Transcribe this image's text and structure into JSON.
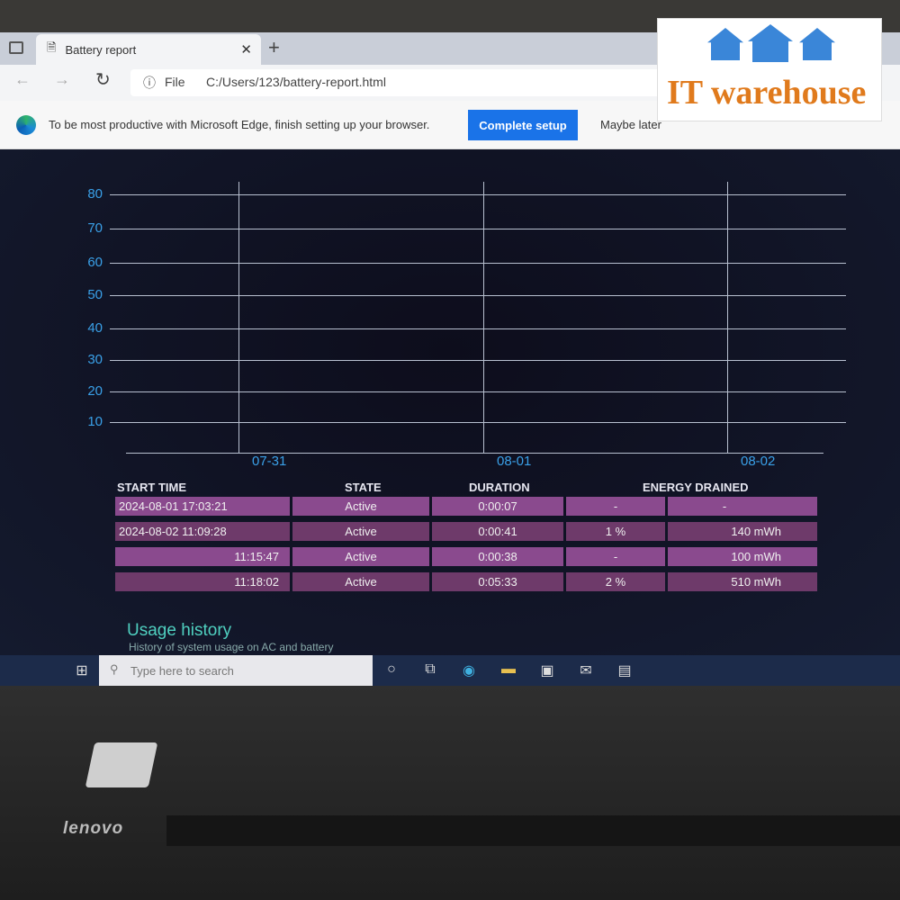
{
  "browser": {
    "tab_title": "Battery report",
    "address_prefix": "File",
    "url": "C:/Users/123/battery-report.html"
  },
  "infobar": {
    "message": "To be most productive with Microsoft Edge, finish setting up your browser.",
    "primary": "Complete setup",
    "secondary": "Maybe later"
  },
  "chart": {
    "y_ticks": [
      "80",
      "70",
      "60",
      "50",
      "40",
      "30",
      "20",
      "10"
    ],
    "x_ticks": [
      "07-31",
      "08-01",
      "08-02"
    ]
  },
  "table": {
    "headers": [
      "START TIME",
      "STATE",
      "DURATION",
      "ENERGY DRAINED"
    ],
    "rows": [
      {
        "start": "2024-08-01  17:03:21",
        "state": "Active",
        "duration": "0:00:07",
        "pct": "-",
        "mwh": "-"
      },
      {
        "start": "2024-08-02  11:09:28",
        "state": "Active",
        "duration": "0:00:41",
        "pct": "1 %",
        "mwh": "140 mWh"
      },
      {
        "start": "11:15:47",
        "state": "Active",
        "duration": "0:00:38",
        "pct": "-",
        "mwh": "100 mWh"
      },
      {
        "start": "11:18:02",
        "state": "Active",
        "duration": "0:05:33",
        "pct": "2 %",
        "mwh": "510 mWh"
      }
    ]
  },
  "usage": {
    "title": "Usage history",
    "subtitle": "History of system usage on AC and battery"
  },
  "taskbar": {
    "search_placeholder": "Type here to search"
  },
  "laptop": {
    "brand": "lenovo"
  },
  "watermark": {
    "text": "IT warehouse"
  },
  "colors": {
    "row_a": "#8a4a8e",
    "row_b": "#6e3a6a",
    "accent": "#1a73e8",
    "axis": "#3aa0e8"
  }
}
